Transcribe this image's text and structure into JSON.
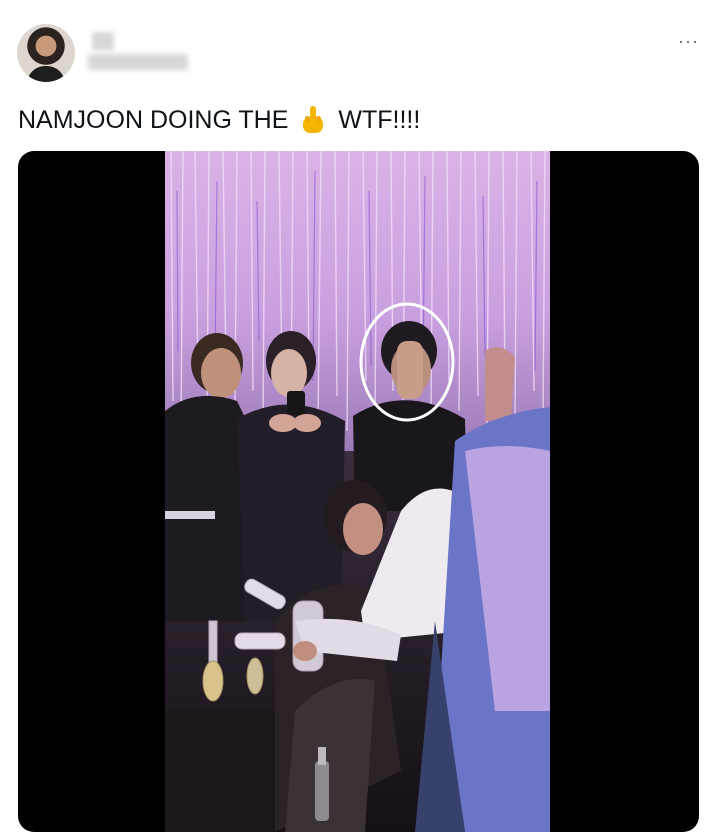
{
  "post": {
    "author_name_redacted": true,
    "more_label": "···",
    "text_before": "NAMJOON DOING THE",
    "emoji_icon": "middle-finger-icon",
    "text_after": "WTF!!!!"
  },
  "colors": {
    "text": "#0f1419",
    "muted": "#536471",
    "media_background": "#000000",
    "highlight_circle": "#ffffff"
  }
}
